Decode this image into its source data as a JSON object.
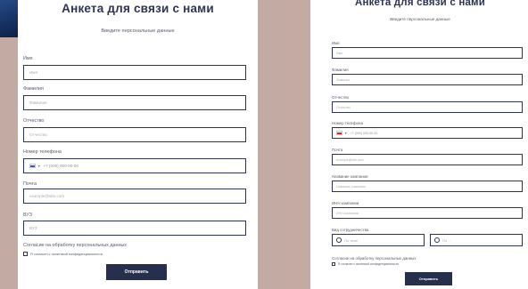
{
  "form_title": "Анкета для связи с нами",
  "form_subtitle": "Введите персональные данные",
  "left_form": {
    "name": {
      "label": "Имя",
      "placeholder": "Имя"
    },
    "surname": {
      "label": "Фамилия",
      "placeholder": "Фамилия"
    },
    "patronymic": {
      "label": "Отчество",
      "placeholder": "Отчество"
    },
    "phone": {
      "label": "Номер телефона",
      "placeholder": "+7 (000) 000-00-00"
    },
    "email": {
      "label": "Почта",
      "placeholder": "example@site.com"
    },
    "university": {
      "label": "ВУЗ",
      "placeholder": "ВУЗ"
    },
    "consent_title": "Согласие на обработку персональных данных",
    "consent_text": "Я согласен с политикой конфиденциальности",
    "submit_label": "Отправить"
  },
  "right_form": {
    "name": {
      "label": "Имя",
      "placeholder": "Имя"
    },
    "surname": {
      "label": "Фамилия",
      "placeholder": "Фамилия"
    },
    "patronymic": {
      "label": "Отчество",
      "placeholder": "Отчество"
    },
    "phone": {
      "label": "Номер телефона",
      "placeholder": "+7 (000) 000-00-00"
    },
    "email": {
      "label": "Почта",
      "placeholder": "example@site.com"
    },
    "company": {
      "label": "Название компании",
      "placeholder": "Название компании"
    },
    "inn": {
      "label": "ИНН компании",
      "placeholder": "ИНН компании"
    },
    "cooperation": {
      "label": "Вид сотрудничества",
      "options": [
        "По теме",
        "По ..."
      ]
    },
    "consent_title": "Согласие на обработку персональных данных",
    "consent_text": "Я согласен с политикой конфиденциальности",
    "submit_label": "Отправить"
  },
  "colors": {
    "background": "#c3aaa2",
    "accent": "#26304d",
    "panel": "#ffffff",
    "corner_accent": "#1c3a72"
  }
}
